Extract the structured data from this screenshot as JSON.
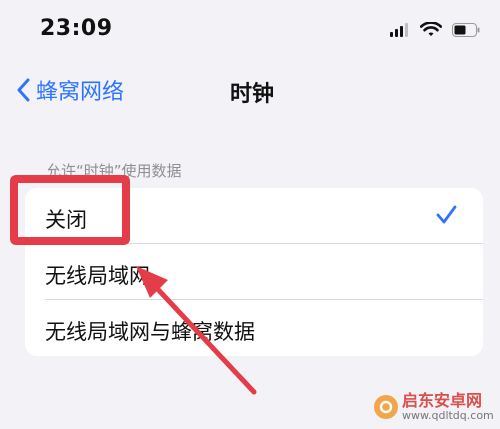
{
  "status_bar": {
    "time": "23:09"
  },
  "nav_bar": {
    "back_label": "蜂窝网络",
    "title": "时钟"
  },
  "section": {
    "header": "允许“时钟”使用数据"
  },
  "options": [
    {
      "label": "关闭",
      "selected": true
    },
    {
      "label": "无线局域网",
      "selected": false
    },
    {
      "label": "无线局域网与蜂窝数据",
      "selected": false
    }
  ],
  "watermark": {
    "name": "启东安卓网",
    "url": "www.qdltdq.com"
  },
  "colors": {
    "accent": "#2f74ff",
    "highlight": "#e53c4a",
    "background": "#f2f2f7"
  },
  "icons": {
    "signal": "signal-icon",
    "wifi": "wifi-icon",
    "battery": "battery-icon",
    "back": "chevron-left-icon",
    "check": "checkmark-icon"
  }
}
